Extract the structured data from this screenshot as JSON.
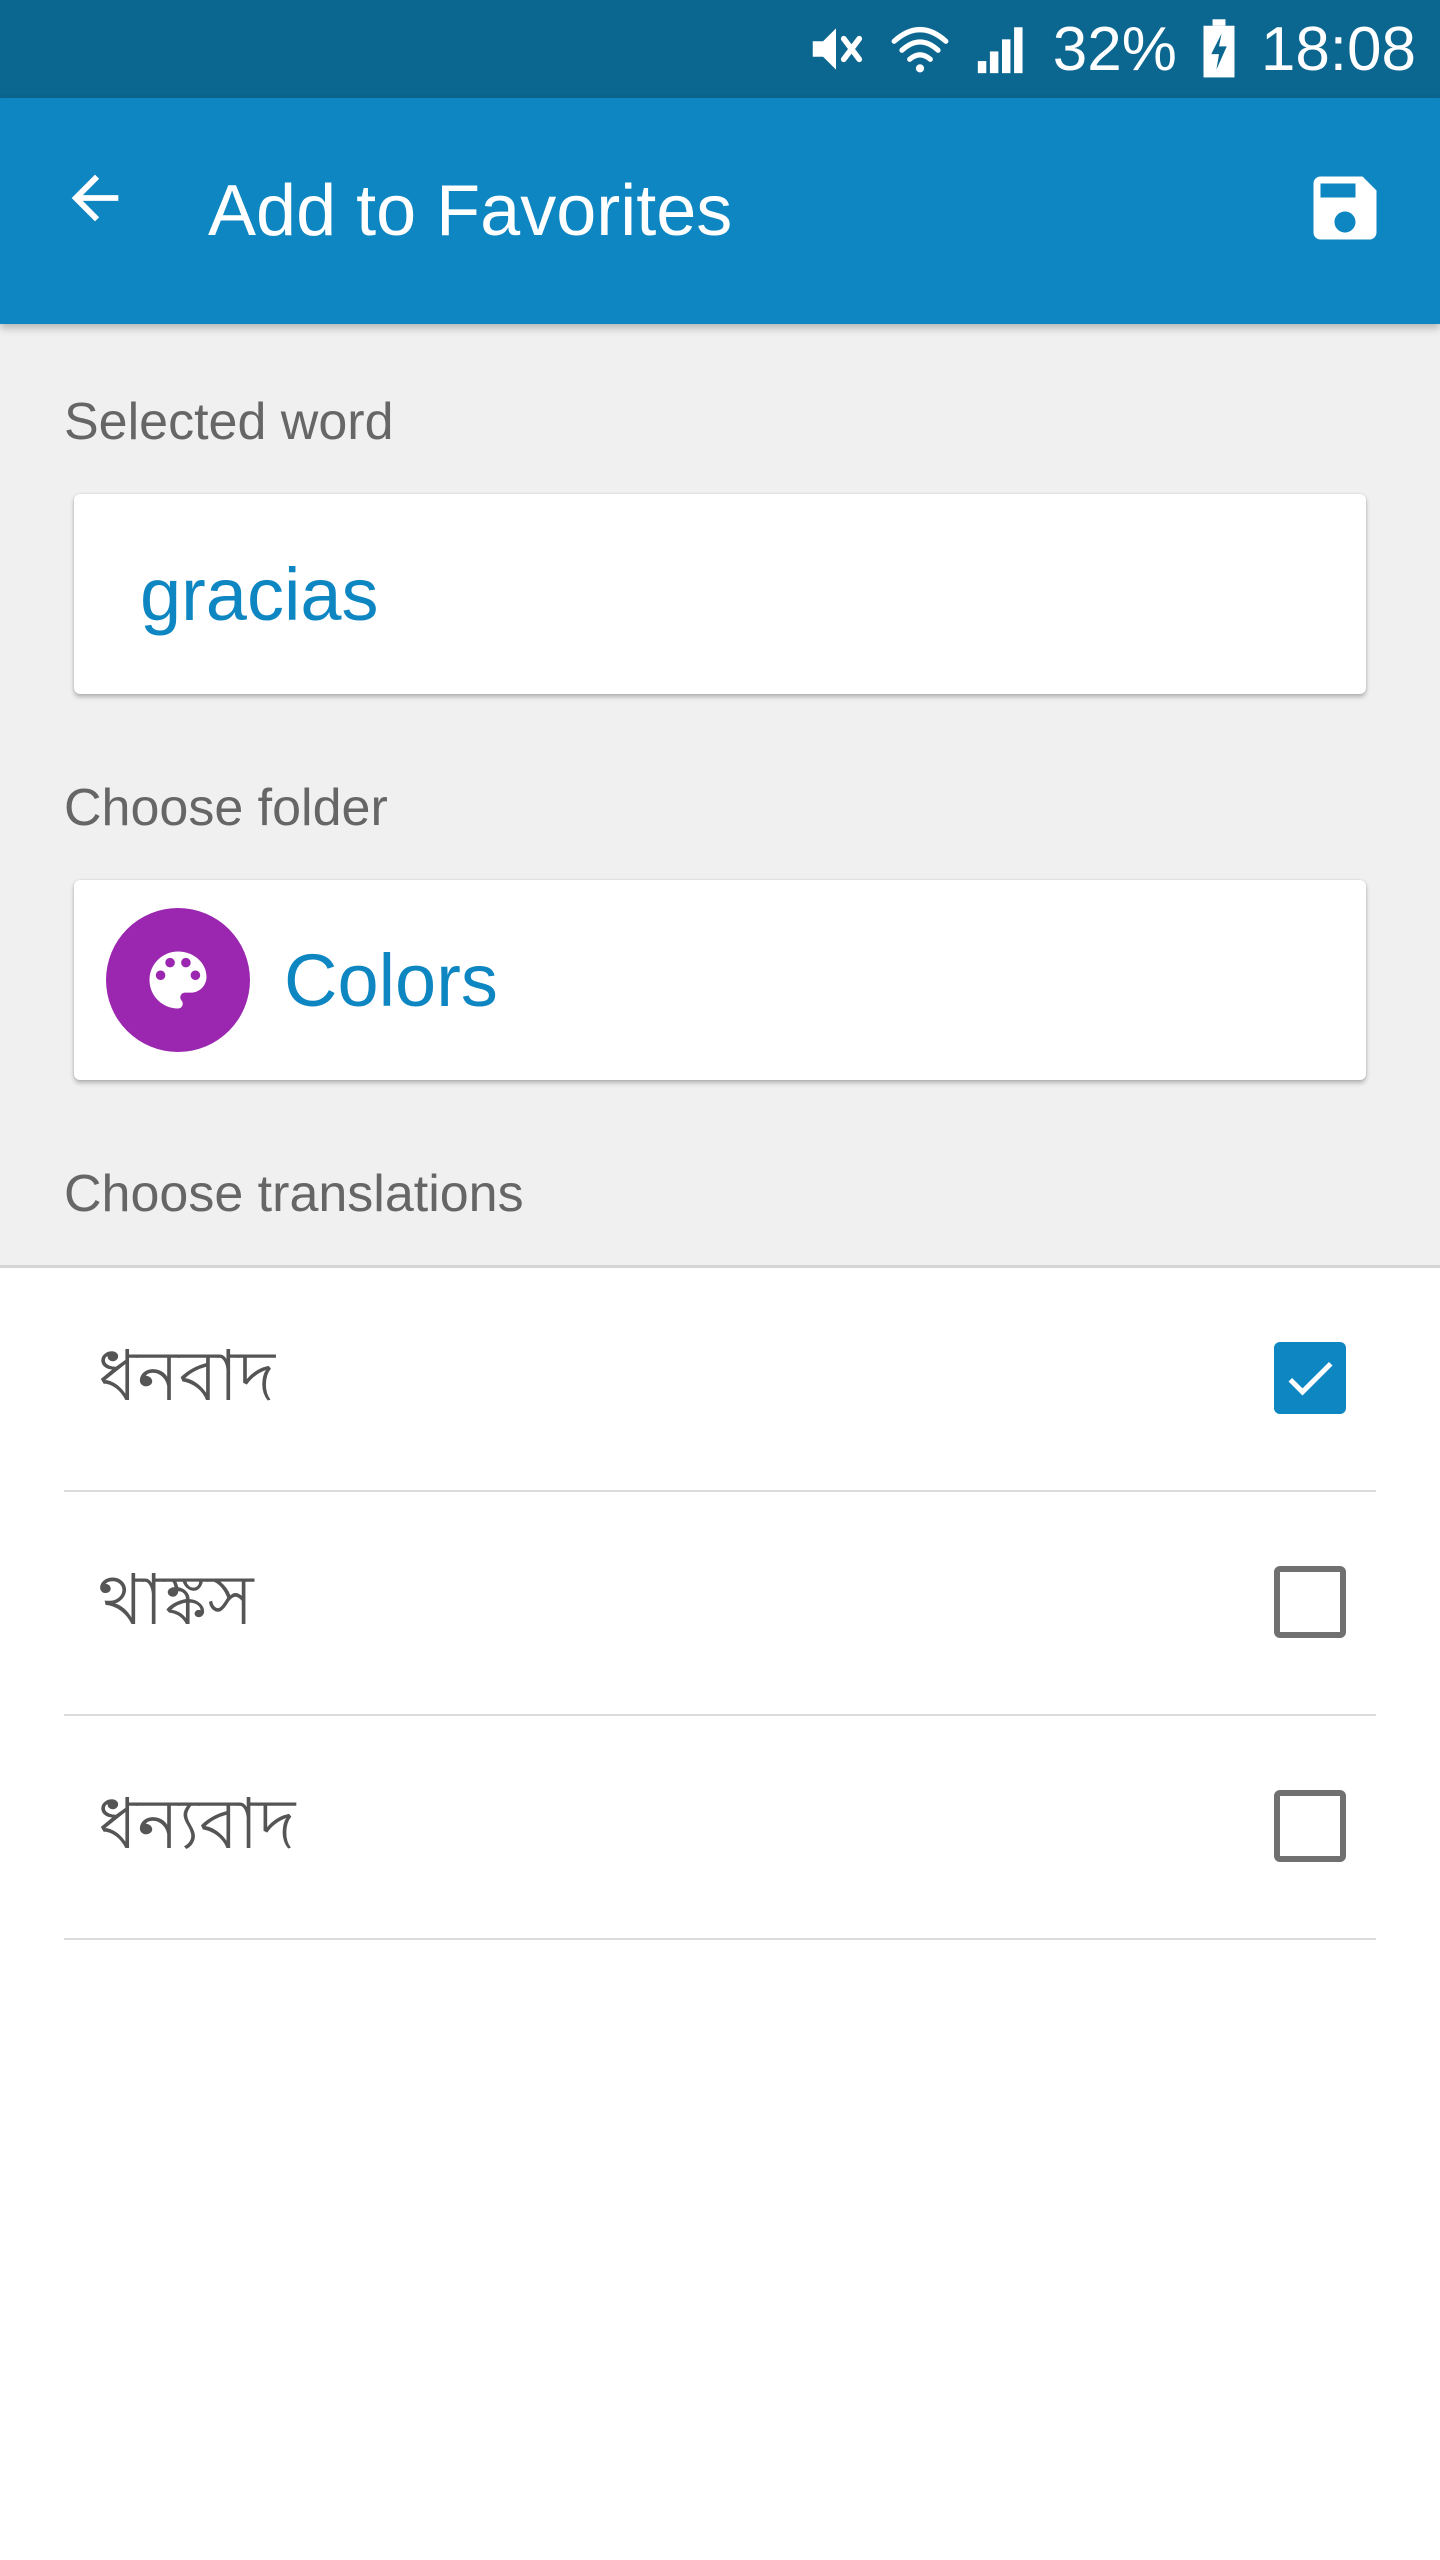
{
  "status_bar": {
    "battery": "32%",
    "time": "18:08",
    "icons": [
      "mute-icon",
      "wifi-icon",
      "signal-icon",
      "battery-charging-icon"
    ]
  },
  "app_bar": {
    "title": "Add to Favorites",
    "back_icon": "arrow-back-icon",
    "save_icon": "save-icon"
  },
  "form": {
    "selected_word_label": "Selected word",
    "selected_word": "gracias",
    "folder_label": "Choose folder",
    "folder": {
      "name": "Colors",
      "icon": "palette-icon",
      "color": "#9b27b0"
    },
    "translations_label": "Choose translations"
  },
  "translations": [
    {
      "text": "ধনবাদ",
      "checked": true
    },
    {
      "text": "থাঙ্কস",
      "checked": false
    },
    {
      "text": "ধন্যবাদ",
      "checked": false
    }
  ],
  "colors": {
    "status_bar": "#0b6690",
    "app_bar": "#0e86c2",
    "accent": "#0e86c2",
    "background": "#f0f0f0"
  }
}
